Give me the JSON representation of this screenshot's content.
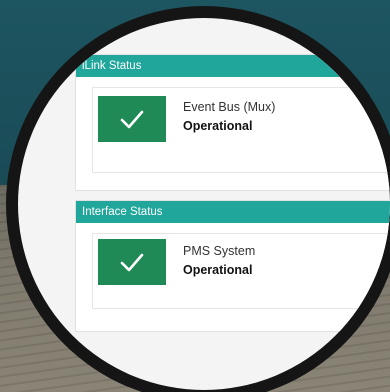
{
  "ilink": {
    "header": "iLink Status",
    "items": [
      {
        "name": "Event Bus (Mux)",
        "status": "Operational"
      }
    ]
  },
  "interface": {
    "header": "Interface Status",
    "items": [
      {
        "name": "PMS System",
        "status": "Operational"
      }
    ]
  },
  "colors": {
    "header": "#20a69a",
    "ok_tile": "#1f8a55",
    "background": "#1d5560"
  },
  "icons": [
    "checkmark-icon"
  ]
}
